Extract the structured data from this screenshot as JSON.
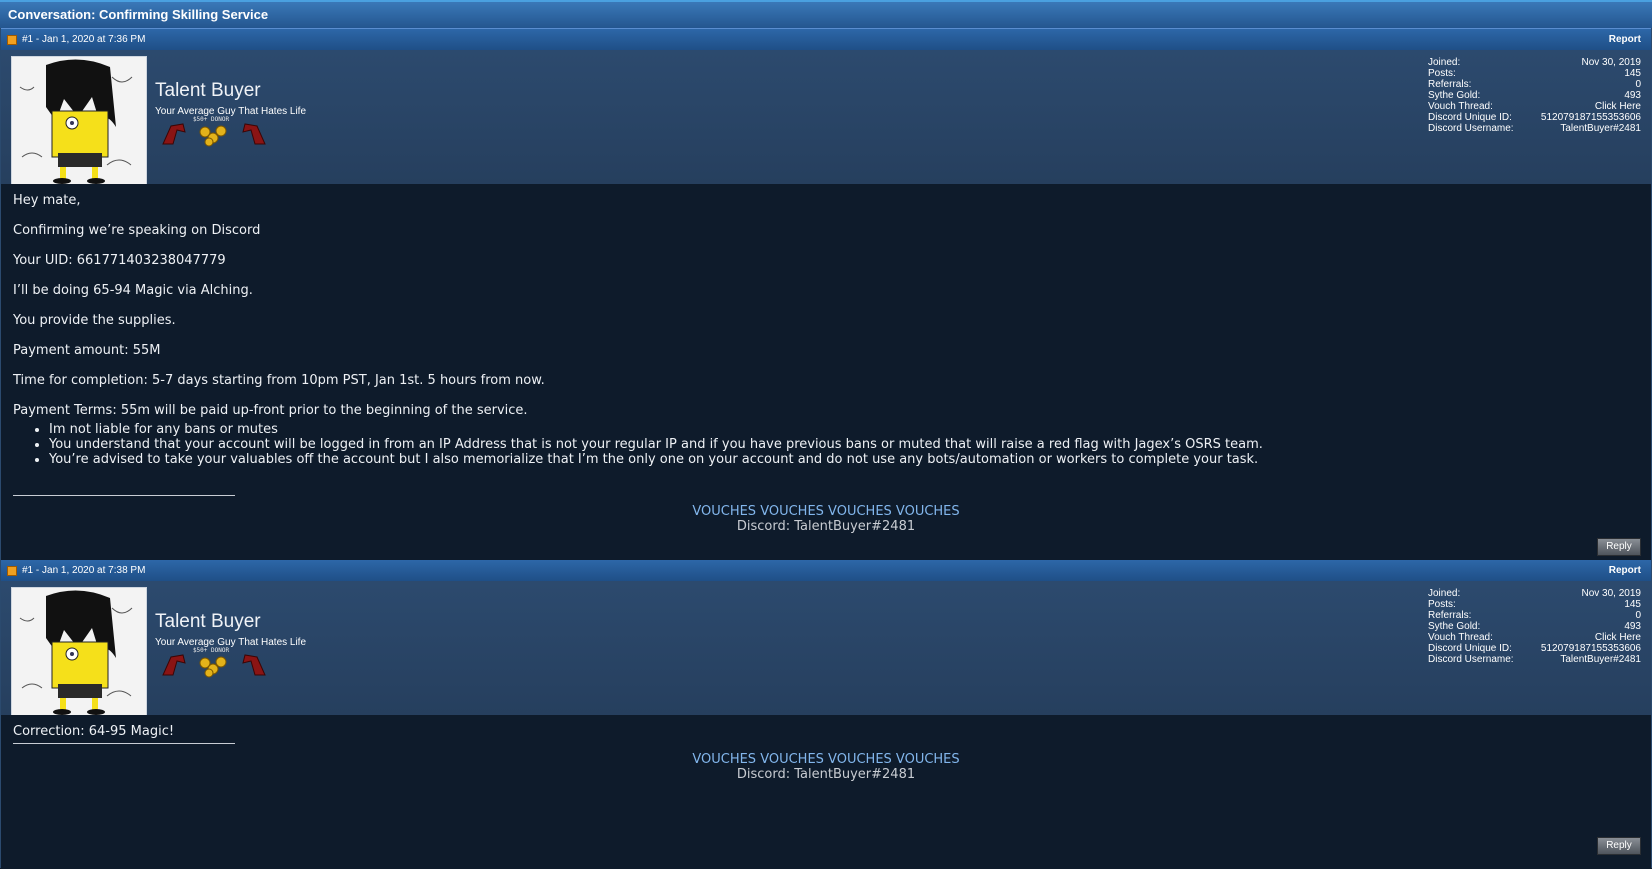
{
  "window": {
    "title": "Conversation: Confirming Skilling Service"
  },
  "user": {
    "name": "Talent Buyer",
    "title": "Your Average Guy That Hates Life",
    "donor_label": "$50+ DONOR",
    "stats": [
      {
        "label": "Joined:",
        "value": "Nov 30, 2019"
      },
      {
        "label": "Posts:",
        "value": "145"
      },
      {
        "label": "Referrals:",
        "value": "0"
      },
      {
        "label": "Sythe Gold:",
        "value": "493"
      },
      {
        "label": "Vouch Thread:",
        "value": "Click Here"
      },
      {
        "label": "Discord Unique ID:",
        "value": "512079187155353606"
      },
      {
        "label": "Discord Username:",
        "value": "TalentBuyer#2481"
      }
    ]
  },
  "posts": [
    {
      "meta": "#1 - Jan 1, 2020 at 7:36 PM",
      "report_label": "Report",
      "reply_label": "Reply",
      "lines": [
        "Hey mate,",
        "Confirming we’re speaking on Discord",
        "Your UID: 661771403238047779",
        "I’ll be doing 65-94 Magic via Alching.",
        "You provide the supplies.",
        "Payment amount: 55M",
        "Time for completion: 5-7 days starting from 10pm PST, Jan 1st. 5 hours from now.",
        "Payment Terms: 55m will be paid up-front prior to the beginning of the service."
      ],
      "bullets": [
        "Im not liable for any bans or mutes",
        "You understand that your account will be logged in from an IP Address that is not your regular IP and if you have previous bans or muted that will raise a red flag with Jagex’s OSRS team.",
        "You’re advised to take your valuables off the account but I also memorialize that I’m the only one on your account and do not use any bots/automation or workers to complete your task."
      ]
    },
    {
      "meta": "#1 - Jan 1, 2020 at 7:38 PM",
      "report_label": "Report",
      "reply_label": "Reply",
      "lines": [
        "Correction: 64-95 Magic!"
      ]
    }
  ],
  "signature": {
    "link": "VOUCHES VOUCHES VOUCHES VOUCHES",
    "discord": "Discord: TalentBuyer#2481"
  },
  "colors": {
    "accent": "#2d67a8",
    "background": "#0e1b2b",
    "link": "#82b6ec"
  }
}
